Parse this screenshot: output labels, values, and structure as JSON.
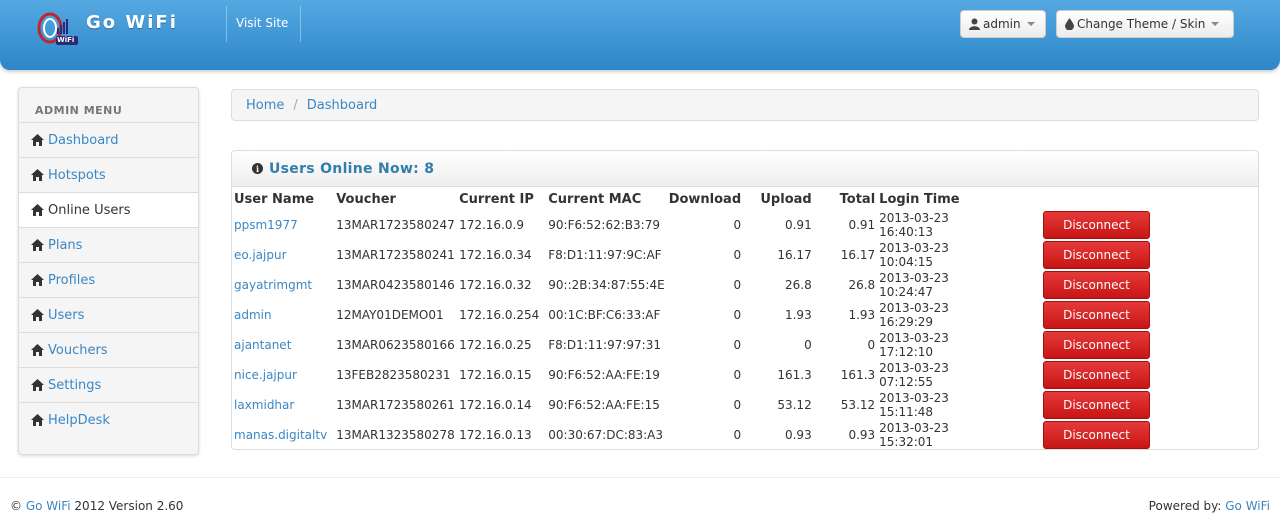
{
  "header": {
    "brand": "Go WiFi",
    "logo_text": "WiFi",
    "visit_site": "Visit Site",
    "user_button": "admin",
    "theme_button": "Change Theme / Skin"
  },
  "sidebar": {
    "header": "ADMIN MENU",
    "items": [
      {
        "label": "Dashboard"
      },
      {
        "label": "Hotspots"
      },
      {
        "label": "Online Users"
      },
      {
        "label": "Plans"
      },
      {
        "label": "Profiles"
      },
      {
        "label": "Users"
      },
      {
        "label": "Vouchers"
      },
      {
        "label": "Settings"
      },
      {
        "label": "HelpDesk"
      }
    ],
    "active_index": 2
  },
  "breadcrumb": {
    "home": "Home",
    "separator": "/",
    "current": "Dashboard"
  },
  "panel": {
    "title": "Users Online Now: 8",
    "columns": [
      "User Name",
      "Voucher",
      "Current IP",
      "Current MAC",
      "Download",
      "Upload",
      "Total",
      "Login Time"
    ],
    "action_label": "Disconnect",
    "rows": [
      {
        "user": "ppsm1977",
        "voucher": "13MAR1723580247",
        "ip": "172.16.0.9",
        "mac": "90:F6:52:62:B3:79",
        "download": "0",
        "upload": "0.91",
        "total": "0.91",
        "login": "2013-03-23 16:40:13"
      },
      {
        "user": "eo.jajpur",
        "voucher": "13MAR1723580241",
        "ip": "172.16.0.34",
        "mac": "F8:D1:11:97:9C:AF",
        "download": "0",
        "upload": "16.17",
        "total": "16.17",
        "login": "2013-03-23 10:04:15"
      },
      {
        "user": "gayatrimgmt",
        "voucher": "13MAR0423580146",
        "ip": "172.16.0.32",
        "mac": "90::2B:34:87:55:4E",
        "download": "0",
        "upload": "26.8",
        "total": "26.8",
        "login": "2013-03-23 10:24:47"
      },
      {
        "user": "admin",
        "voucher": "12MAY01DEMO01",
        "ip": "172.16.0.254",
        "mac": "00:1C:BF:C6:33:AF",
        "download": "0",
        "upload": "1.93",
        "total": "1.93",
        "login": "2013-03-23 16:29:29"
      },
      {
        "user": "ajantanet",
        "voucher": "13MAR0623580166",
        "ip": "172.16.0.25",
        "mac": "F8:D1:11:97:97:31",
        "download": "0",
        "upload": "0",
        "total": "0",
        "login": "2013-03-23 17:12:10"
      },
      {
        "user": "nice.jajpur",
        "voucher": "13FEB2823580231",
        "ip": "172.16.0.15",
        "mac": "90:F6:52:AA:FE:19",
        "download": "0",
        "upload": "161.3",
        "total": "161.3",
        "login": "2013-03-23 07:12:55"
      },
      {
        "user": "laxmidhar",
        "voucher": "13MAR1723580261",
        "ip": "172.16.0.14",
        "mac": "90:F6:52:AA:FE:15",
        "download": "0",
        "upload": "53.12",
        "total": "53.12",
        "login": "2013-03-23 15:11:48"
      },
      {
        "user": "manas.digitaltv",
        "voucher": "13MAR1323580278",
        "ip": "172.16.0.13",
        "mac": "00:30:67:DC:83:A3",
        "download": "0",
        "upload": "0.93",
        "total": "0.93",
        "login": "2013-03-23 15:32:01"
      }
    ]
  },
  "footer": {
    "copyright_prefix": "©",
    "brand_link": "Go WiFi",
    "copyright_suffix": "2012 Version 2.60",
    "powered_prefix": "Powered by:",
    "powered_link": "Go WiFi"
  },
  "colors": {
    "header_blue": "#3d97d6",
    "link_blue": "#3a87c5",
    "danger_red": "#d42020"
  }
}
